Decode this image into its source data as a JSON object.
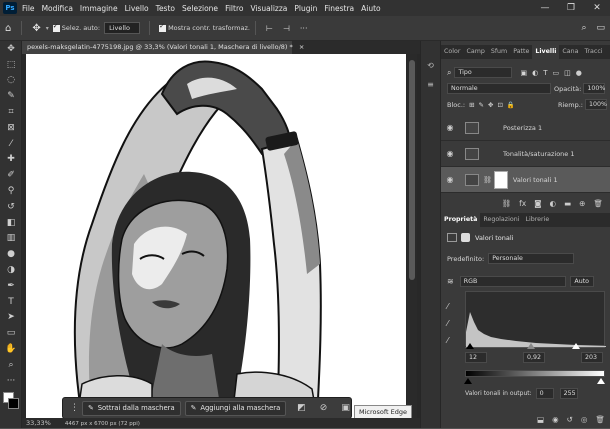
{
  "menu": {
    "logo": "Ps",
    "items": [
      "File",
      "Modifica",
      "Immagine",
      "Livello",
      "Testo",
      "Selezione",
      "Filtro",
      "Visualizza",
      "Plugin",
      "Finestra",
      "Aiuto"
    ],
    "minimize": "—",
    "maximize": "❐",
    "close": "✕"
  },
  "options": {
    "auto_select_label": "Selez. auto:",
    "auto_select_target": "Livello",
    "show_transform_label": "Mostra contr. trasformaz."
  },
  "document": {
    "tab_title": "pexels-maksgelatin-4775198.jpg @ 33,3% (Valori tonali 1, Maschera di livello/8) *",
    "tab_close": "×",
    "zoom": "33,33%",
    "doc_size": "4467 px x 6700 px (72 ppi)"
  },
  "taskbar": {
    "subtract_label": "Sottrai dalla maschera",
    "add_label": "Aggiungi alla maschera"
  },
  "tooltip": "Microsoft Edge",
  "layers_panel": {
    "tabs": [
      "Color",
      "Camp",
      "Sfum",
      "Patte",
      "Livelli",
      "Cana",
      "Tracci"
    ],
    "active_tab": "Livelli",
    "filter_kind": "Tipo",
    "blend_mode": "Normale",
    "opacity_label": "Opacità:",
    "opacity": "100%",
    "lock_label": "Bloc.:",
    "fill_label": "Riemp.:",
    "fill": "100%",
    "layers": [
      {
        "name": "Posterizza 1"
      },
      {
        "name": "Tonalità/saturazione 1"
      },
      {
        "name": "Valori tonali 1"
      }
    ],
    "footer_icons": [
      "link-icon",
      "fx-icon",
      "mask-icon",
      "adjustment-icon",
      "folder-icon",
      "new-layer-icon",
      "trash-icon"
    ]
  },
  "properties_panel": {
    "tabs": [
      "Proprietà",
      "Regolazioni",
      "Librerie"
    ],
    "active_tab": "Proprietà",
    "title": "Valori tonali",
    "preset_label": "Predefinito:",
    "preset": "Personale",
    "channel": "RGB",
    "auto_label": "Auto",
    "input_black": "12",
    "input_gamma": "0,92",
    "input_white": "203",
    "output_label": "Valori tonali in output:",
    "output_black": "0",
    "output_white": "255",
    "colors": {
      "accent": "#31a8ff",
      "panel": "#3a3a3a",
      "dark": "#323232"
    }
  }
}
